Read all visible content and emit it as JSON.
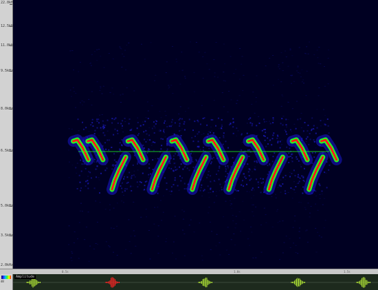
{
  "app": {
    "title": ""
  },
  "frequency_axis": {
    "labels": [
      "22.0kHz",
      "12.5kHz",
      "11.0kHz",
      "9.5kHz",
      "8.0kHz",
      "6.5kHz",
      "5.0kHz",
      "3.5kHz",
      "2.0kHz"
    ]
  },
  "time_ruler": {
    "labels": [
      "0.5s",
      "1.0s",
      "1.5s"
    ]
  },
  "legend": {
    "text": "dB",
    "values": "-100\n-50"
  },
  "waveform": {
    "label": "Amplitude"
  },
  "colors": {
    "background": "#000022",
    "low": "#1a1acc",
    "mid": "#22ff22",
    "high": "#ff1a1a",
    "waveform": "#aadd33",
    "waveform_selected": "#ff2222"
  },
  "spectrogram_calls": [
    {
      "t": 0.18,
      "kind": "down"
    },
    {
      "t": 0.22,
      "kind": "down"
    },
    {
      "t": 0.29,
      "kind": "up"
    },
    {
      "t": 0.33,
      "kind": "down"
    },
    {
      "t": 0.4,
      "kind": "up"
    },
    {
      "t": 0.45,
      "kind": "down"
    },
    {
      "t": 0.51,
      "kind": "up"
    },
    {
      "t": 0.55,
      "kind": "down"
    },
    {
      "t": 0.61,
      "kind": "up"
    },
    {
      "t": 0.66,
      "kind": "down"
    },
    {
      "t": 0.72,
      "kind": "up"
    },
    {
      "t": 0.78,
      "kind": "down"
    },
    {
      "t": 0.83,
      "kind": "up"
    },
    {
      "t": 0.86,
      "kind": "down"
    }
  ]
}
